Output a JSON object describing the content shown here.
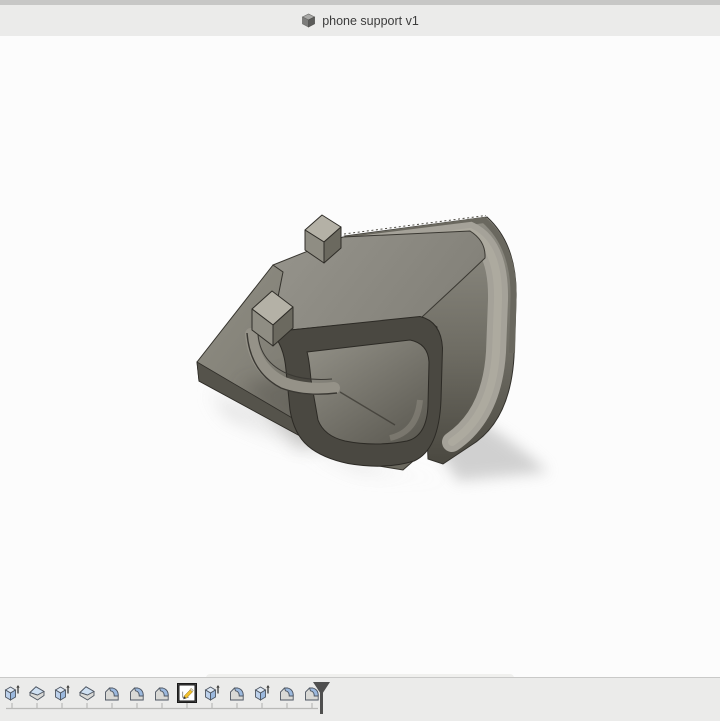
{
  "titlebar": {
    "title": "phone support v1",
    "icon": "model-cube-icon"
  },
  "viewport": {
    "content": "3D model of a phone support stand, shaded gray, isometric view with drop shadow",
    "background": "#fcfcfc"
  },
  "nav_toolbar": {
    "items": [
      {
        "id": "orbit",
        "dropdown": true
      },
      {
        "id": "look-at",
        "dropdown": false
      },
      {
        "id": "pan",
        "dropdown": false
      },
      {
        "id": "zoom",
        "dropdown": false
      },
      {
        "id": "fit",
        "dropdown": true
      },
      {
        "id": "display-settings",
        "dropdown": true,
        "group_start": true
      },
      {
        "id": "grid-and-snaps",
        "dropdown": true
      },
      {
        "id": "viewports",
        "dropdown": true
      }
    ]
  },
  "timeline": {
    "features": [
      {
        "type": "extrude"
      },
      {
        "type": "chamfer"
      },
      {
        "type": "extrude"
      },
      {
        "type": "chamfer"
      },
      {
        "type": "fillet"
      },
      {
        "type": "fillet"
      },
      {
        "type": "fillet"
      },
      {
        "type": "sketch",
        "selected": true
      },
      {
        "type": "extrude"
      },
      {
        "type": "fillet"
      },
      {
        "type": "extrude"
      },
      {
        "type": "fillet"
      },
      {
        "type": "fillet"
      }
    ],
    "playhead": "after-last-feature"
  },
  "colors": {
    "tabbar_bg": "#ebebea",
    "viewport_bg": "#fcfcfc",
    "toolbar_bg": "#f0f0ee",
    "timeline_bg": "#ebebea",
    "model_body": "#8b8980",
    "model_dark": "#4b4942",
    "model_highlight": "#a6a399",
    "feature_icon_blue": "#a9c3e2",
    "sketch_pencil_yellow": "#f2c12e",
    "playhead_gray": "#4f4f4f"
  }
}
